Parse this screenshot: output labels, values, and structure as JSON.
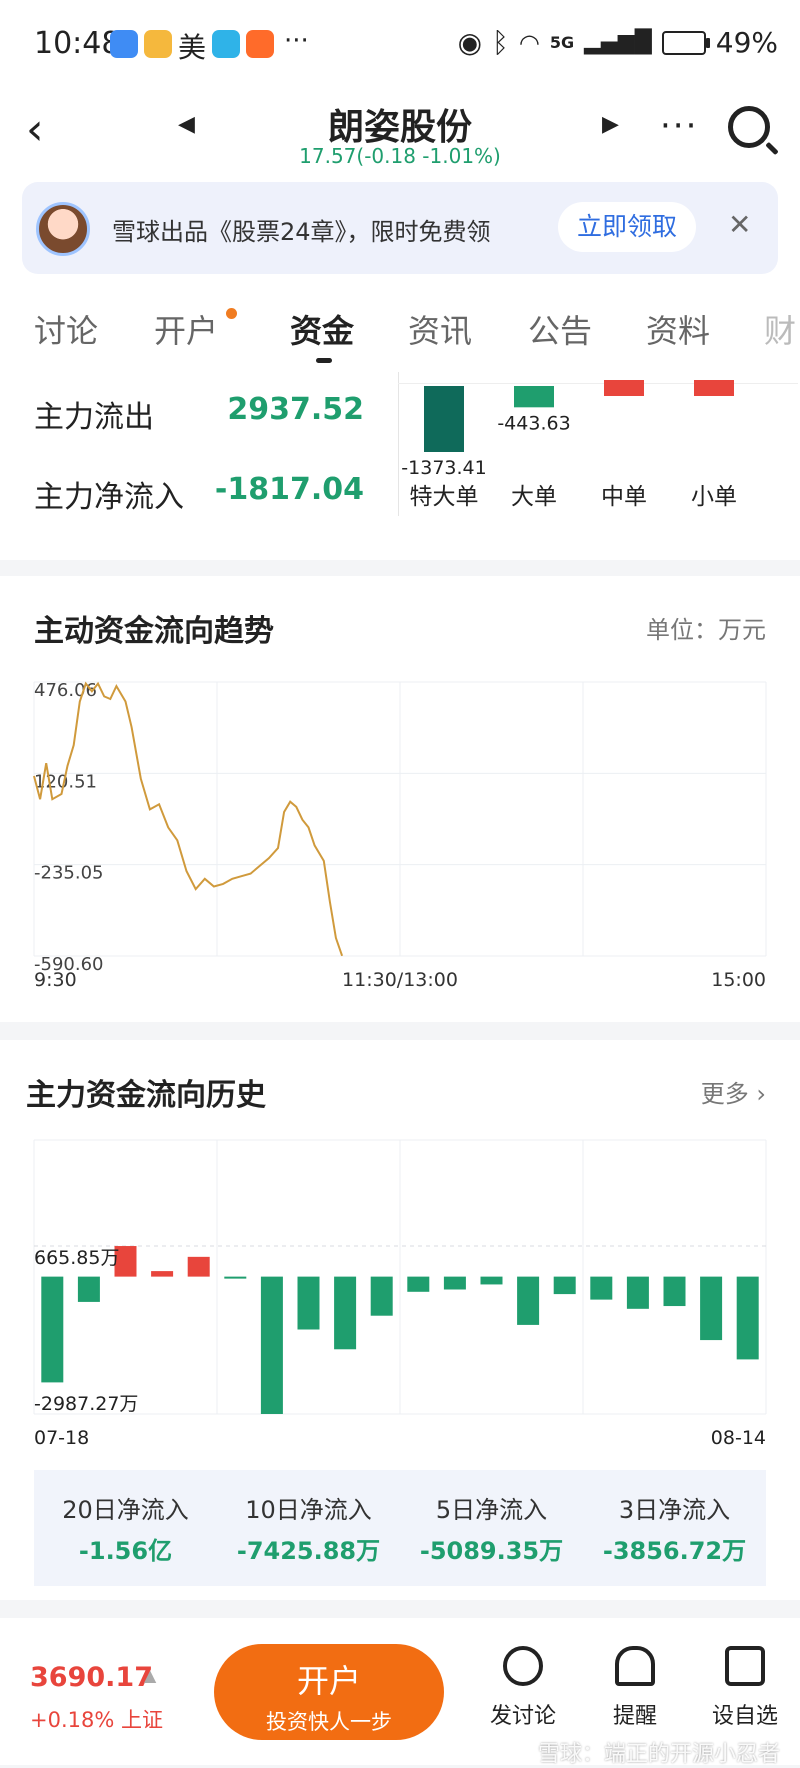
{
  "status_bar": {
    "time": "10:48",
    "mei": "美",
    "more": "···",
    "network": "5G",
    "battery": "49%"
  },
  "header": {
    "title": "朗姿股份",
    "price_line": "17.57(-0.18 -1.01%)"
  },
  "promo": {
    "text": "雪球出品《股票24章》，限时免费领",
    "cta": "立即领取"
  },
  "tabs": [
    "讨论",
    "开户",
    "资金",
    "资讯",
    "公告",
    "资料",
    "财"
  ],
  "flow_summary": {
    "outflow_label": "主力流出",
    "outflow_value": "2937.52",
    "net_label": "主力净流入",
    "net_value": "-1817.04",
    "bars": [
      {
        "label": "特大单",
        "value": -1373.41,
        "text": "-1373.41"
      },
      {
        "label": "大单",
        "value": -443.63,
        "text": "-443.63"
      },
      {
        "label": "中单",
        "value": 1,
        "text": ""
      },
      {
        "label": "小单",
        "value": 1,
        "text": ""
      }
    ]
  },
  "trend": {
    "title": "主动资金流向趋势",
    "unit": "单位：万元",
    "chart_data": {
      "type": "line",
      "y_ticks": [
        "476.06",
        "120.51",
        "-235.05",
        "-590.60"
      ],
      "ylim": [
        -590.6,
        476.06
      ],
      "x_ticks": [
        "9:30",
        "11:30/13:00",
        "15:00"
      ],
      "series": [
        {
          "values": [
            [
              0,
              110
            ],
            [
              2,
              20
            ],
            [
              4,
              160
            ],
            [
              6,
              20
            ],
            [
              9,
              40
            ],
            [
              11,
              150
            ],
            [
              13,
              230
            ],
            [
              15,
              400
            ],
            [
              17,
              470
            ],
            [
              19,
              440
            ],
            [
              21,
              470
            ],
            [
              23,
              420
            ],
            [
              25,
              410
            ],
            [
              27,
              460
            ],
            [
              30,
              400
            ],
            [
              32,
              300
            ],
            [
              35,
              100
            ],
            [
              38,
              -20
            ],
            [
              41,
              0
            ],
            [
              44,
              -90
            ],
            [
              47,
              -140
            ],
            [
              50,
              -260
            ],
            [
              53,
              -330
            ],
            [
              56,
              -290
            ],
            [
              59,
              -320
            ],
            [
              62,
              -310
            ],
            [
              65,
              -290
            ],
            [
              68,
              -280
            ],
            [
              71,
              -270
            ],
            [
              74,
              -240
            ],
            [
              77,
              -210
            ],
            [
              80,
              -170
            ],
            [
              82,
              -30
            ],
            [
              84,
              10
            ],
            [
              86,
              -10
            ],
            [
              88,
              -60
            ],
            [
              90,
              -90
            ],
            [
              92,
              -160
            ],
            [
              95,
              -220
            ],
            [
              97,
              -380
            ],
            [
              99,
              -520
            ],
            [
              101,
              -590
            ]
          ]
        }
      ],
      "x_points_total": 240
    }
  },
  "history": {
    "title": "主力资金流向历史",
    "more": "更多",
    "chart_data": {
      "type": "bar",
      "y_ticks": [
        "665.85万",
        "-2987.27万"
      ],
      "x_ticks": [
        "07-18",
        "08-14"
      ],
      "ylim": [
        -2987.27,
        665.85
      ],
      "values": [
        -2300,
        -550,
        665,
        120,
        430,
        -30,
        -2987,
        -1150,
        -1580,
        -850,
        -330,
        -280,
        -170,
        -1050,
        -380,
        -500,
        -700,
        -640,
        -1380,
        -1800
      ]
    },
    "stats": [
      {
        "label": "20日净流入",
        "value": "-1.56亿"
      },
      {
        "label": "10日净流入",
        "value": "-7425.88万"
      },
      {
        "label": "5日净流入",
        "value": "-5089.35万"
      },
      {
        "label": "3日净流入",
        "value": "-3856.72万"
      }
    ]
  },
  "bottom": {
    "index_value": "3690.17",
    "index_change": "+0.18% 上证",
    "open_account": "开户",
    "open_account_sub": "投资快人一步",
    "post": "发讨论",
    "remind": "提醒",
    "watchlist": "设自选",
    "watermark": "雪球：端正的开源小忍者"
  },
  "colors": {
    "up": "#e8453c",
    "down": "#1f9e6e",
    "line": "#d09a3c",
    "accent": "#f26d12"
  }
}
